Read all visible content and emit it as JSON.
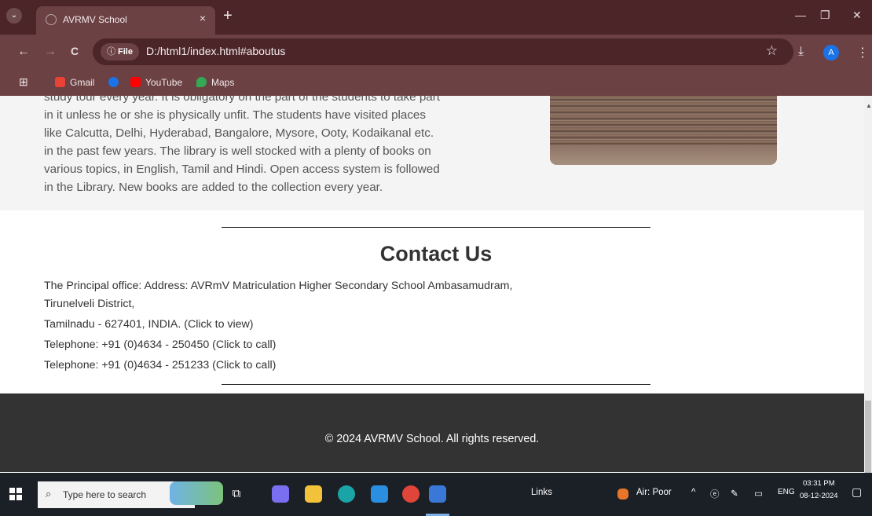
{
  "browser": {
    "tab_title": "AVRMV School",
    "tab_close": "×",
    "new_tab": "+",
    "window_controls": {
      "minimize": "—",
      "maximize": "❐",
      "close": "✕"
    },
    "nav": {
      "back": "←",
      "forward": "→",
      "reload": "C"
    },
    "omnibox": {
      "scheme_label": "File",
      "info_icon": "ⓘ",
      "url": "D:/html1/index.html#aboutus",
      "star": "☆"
    },
    "toolbar_icons": {
      "download": "⤓",
      "menu": "⋮"
    },
    "profile_initial": "A",
    "bookmarks": [
      {
        "label": "Gmail",
        "icon": "gmail-icon"
      },
      {
        "label": "",
        "icon": "blank-icon"
      },
      {
        "label": "YouTube",
        "icon": "youtube-icon"
      },
      {
        "label": "Maps",
        "icon": "maps-icon"
      }
    ]
  },
  "about": {
    "lines": [
      "study tour every year. It is obligatory on the part of the students to take part",
      "in it unless he or she is physically unfit. The students have visited places",
      "like Calcutta, Delhi, Hyderabad, Bangalore, Mysore, Ooty, Kodaikanal etc.",
      "in the past few years. The library is well stocked with a plenty of books on",
      "various topics, in English, Tamil and Hindi. Open access system is followed",
      "in the Library. New books are added to the collection every year."
    ]
  },
  "contact": {
    "title": "Contact Us",
    "address_line1": "The Principal office: Address: AVRmV Matriculation Higher Secondary School Ambasamudram,",
    "address_line2": "Tirunelveli District,",
    "address_line3": "Tamilnadu - 627401, INDIA. (Click to view)",
    "phone1": "Telephone: +91 (0)4634 - 250450 (Click to call)",
    "phone2": "Telephone: +91 (0)4634 - 251233 (Click to call)"
  },
  "footer": {
    "copyright": "© 2024 AVRMV School. All rights reserved."
  },
  "taskbar": {
    "search_placeholder": "Type here to search",
    "links_label": "Links",
    "air_quality": "Air: Poor",
    "language": "ENG",
    "time": "03:31 PM",
    "date": "08-12-2024"
  }
}
